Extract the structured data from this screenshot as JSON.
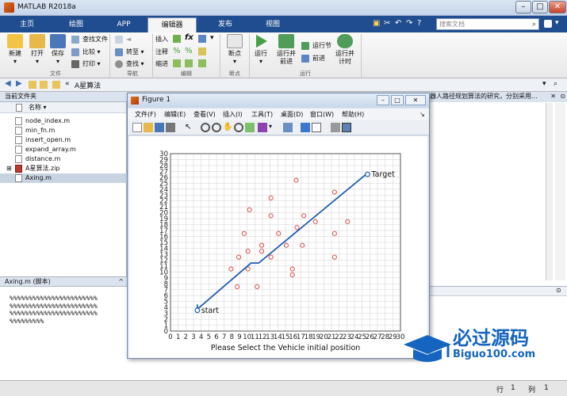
{
  "window": {
    "title": "MATLAB R2018a"
  },
  "tabs": [
    "主页",
    "绘图",
    "APP",
    "编辑器",
    "发布",
    "视图"
  ],
  "active_tab": 3,
  "search": {
    "placeholder": "搜索文档"
  },
  "ribbon": {
    "file_group": {
      "new": "新建",
      "open": "打开",
      "save": "保存",
      "find_files": "查找文件",
      "compare": "比较",
      "print": "打印",
      "label": "文件"
    },
    "nav_group": {
      "goto": "转至",
      "find": "查找",
      "label": "导航"
    },
    "edit_group": {
      "insert": "插入",
      "comment": "注释",
      "indent": "缩进",
      "label": "编辑"
    },
    "breakpoints_group": {
      "breakpoints": "断点",
      "label": "断点"
    },
    "run_group": {
      "run": "运行",
      "run_advance": "运行并\n前进",
      "run_section": "运行节",
      "advance": "前进",
      "run_time": "运行并\n计时",
      "label": "运行"
    }
  },
  "address": {
    "path": "A星算法"
  },
  "current_folder": {
    "header": "当前文件夹",
    "column": "名称",
    "files": [
      "node_index.m",
      "min_fn.m",
      "insert_open.m",
      "expand_array.m",
      "distance.m",
      "A星算法.zip",
      "Axing.m"
    ],
    "selected": 6
  },
  "details": {
    "header": "Axing.m  (脚本)",
    "lines": [
      "%%%%%%%%%%%%%%%%%%%%%%%",
      "%%%%%%%%%%%%%%%%%%%%%%%",
      "%%%%%%%%%%%%%%%%%%%%%%%",
      "%%%%%%%%%"
    ]
  },
  "editor": {
    "header_text": "器人路径规划算法的研究，分别采用..."
  },
  "status": {
    "row_label": "行",
    "row_value": "1",
    "col_label": "列",
    "col_value": "1"
  },
  "figure": {
    "title": "Figure 1",
    "menu": [
      "文件(F)",
      "编辑(E)",
      "查看(V)",
      "插入(I)",
      "工具(T)",
      "桌面(D)",
      "窗口(W)",
      "帮助(H)"
    ]
  },
  "chart_data": {
    "type": "line",
    "xlim": [
      0,
      30
    ],
    "ylim": [
      0,
      30
    ],
    "xticks": [
      0,
      1,
      2,
      3,
      4,
      5,
      6,
      7,
      8,
      9,
      10,
      11,
      12,
      13,
      14,
      15,
      16,
      17,
      18,
      19,
      20,
      21,
      22,
      23,
      24,
      25,
      26,
      27,
      28,
      29,
      30
    ],
    "yticks": [
      0,
      1,
      2,
      3,
      4,
      5,
      6,
      7,
      8,
      9,
      10,
      11,
      12,
      13,
      14,
      15,
      16,
      17,
      18,
      19,
      20,
      21,
      22,
      23,
      24,
      25,
      26,
      27,
      28,
      29,
      30
    ],
    "grid": true,
    "xlabel": "Please Select the Vehicle initial position",
    "obstacles": [
      [
        8.7,
        7.5
      ],
      [
        11.3,
        7.5
      ],
      [
        7.9,
        10.5
      ],
      [
        10.1,
        10.5
      ],
      [
        15.9,
        10.5
      ],
      [
        15.9,
        9.5
      ],
      [
        8.9,
        12.5
      ],
      [
        13.1,
        12.5
      ],
      [
        10.1,
        13.5
      ],
      [
        11.9,
        13.5
      ],
      [
        11.9,
        14.5
      ],
      [
        15.1,
        14.5
      ],
      [
        17.2,
        14.5
      ],
      [
        9.6,
        16.5
      ],
      [
        14.1,
        16.5
      ],
      [
        21.4,
        16.5
      ],
      [
        16.5,
        17.5
      ],
      [
        18.9,
        18.5
      ],
      [
        23.1,
        18.5
      ],
      [
        13.1,
        19.5
      ],
      [
        17.4,
        19.5
      ],
      [
        10.3,
        20.5
      ],
      [
        13.1,
        22.5
      ],
      [
        21.4,
        23.5
      ],
      [
        16.4,
        25.5
      ],
      [
        21.4,
        12.5
      ]
    ],
    "path": [
      [
        3.5,
        4.5
      ],
      [
        3.5,
        3.7
      ],
      [
        10.5,
        11.5
      ],
      [
        11.5,
        11.5
      ],
      [
        25.5,
        26.5
      ]
    ],
    "start": {
      "x": 3.5,
      "y": 3.5,
      "label": "start"
    },
    "target": {
      "x": 25.7,
      "y": 26.5,
      "label": "Target"
    },
    "colors": {
      "path": "#1f5fb0",
      "obstacle": "#e03c3c",
      "grid": "#d0d0d0"
    }
  },
  "watermark": {
    "text": "必过源码",
    "url": "Biguo100.com"
  }
}
